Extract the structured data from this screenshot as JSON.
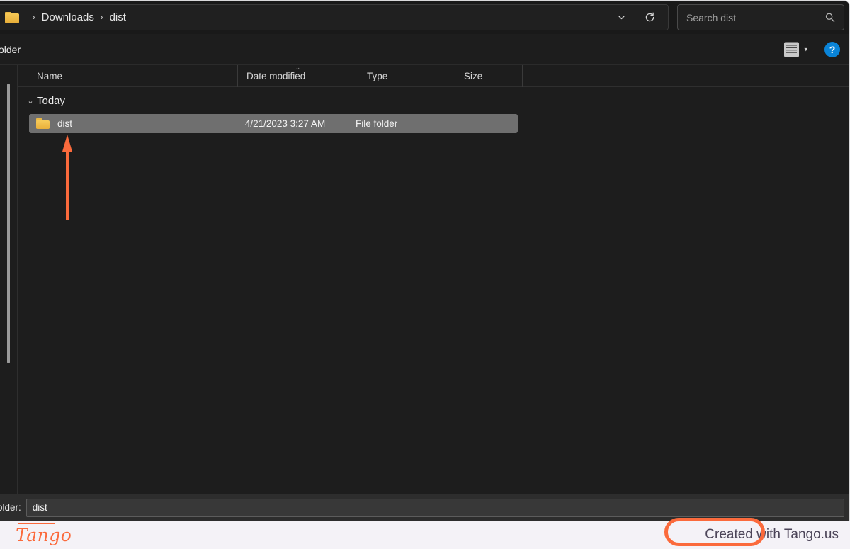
{
  "address_bar": {
    "folder_icon": "folder-icon",
    "breadcrumbs": [
      "Downloads",
      "dist"
    ],
    "separator": "›",
    "history_chevron_icon": "chevron-down-icon",
    "refresh_icon": "refresh-icon",
    "refresh_glyph": "⟳"
  },
  "search": {
    "placeholder": "Search dist",
    "value": "",
    "icon": "search-icon"
  },
  "toolbar": {
    "new_folder_label": "older",
    "view_icon": "list-view-icon",
    "view_caret": "▾",
    "help_label": "?",
    "help_icon": "help-icon"
  },
  "columns": [
    {
      "label": "Name",
      "sorted": false
    },
    {
      "label": "Date modified",
      "sorted": true,
      "sort_caret": "⌄"
    },
    {
      "label": "Type",
      "sorted": false
    },
    {
      "label": "Size",
      "sorted": false
    }
  ],
  "group": {
    "chevron": "⌄",
    "title": "Today"
  },
  "rows": [
    {
      "icon": "folder-icon",
      "name": "dist",
      "date_modified": "4/21/2023 3:27 AM",
      "type": "File folder",
      "size": "",
      "selected": true
    }
  ],
  "bottom_bar": {
    "label": "older:",
    "value": "dist"
  },
  "footer": {
    "logo_text": "Tango",
    "credit_text": "Created with Tango.us"
  },
  "annotations": {
    "arrow": {
      "direction": "up",
      "color": "#fb6a3c",
      "points_at": "dist-folder-row"
    },
    "highlight": {
      "shape": "rounded-rect",
      "color": "#fb6a3c",
      "targets": "created-with-tango-credit"
    }
  },
  "colors": {
    "accent_orange": "#fb6a3c",
    "window_bg": "#1d1d1d",
    "selection_gray": "#6f6f6f",
    "folder_yellow": "#f6c855",
    "help_blue": "#0a84d8",
    "footer_bg": "#f4f2f7"
  }
}
